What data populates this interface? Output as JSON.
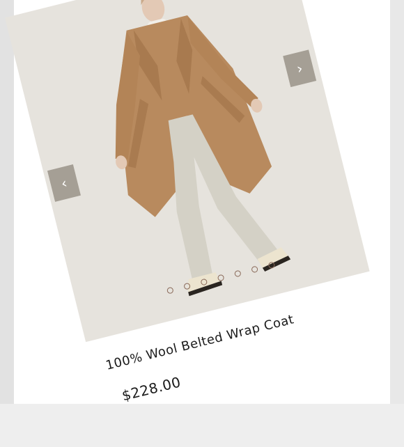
{
  "product": {
    "title": "100% Wool Belted Wrap Coat",
    "price": "$228.00"
  },
  "carousel": {
    "prev_icon": "chevron-left-icon",
    "next_icon": "chevron-right-icon",
    "prev_glyph": "‹",
    "next_glyph": "›",
    "slide_count": 7,
    "active_index": 0
  },
  "colors": {
    "image_bg": "#e6e3dd",
    "arrow_bg": "#a59f95",
    "coat": "#b88a5e",
    "text": "#1b1b1b"
  }
}
